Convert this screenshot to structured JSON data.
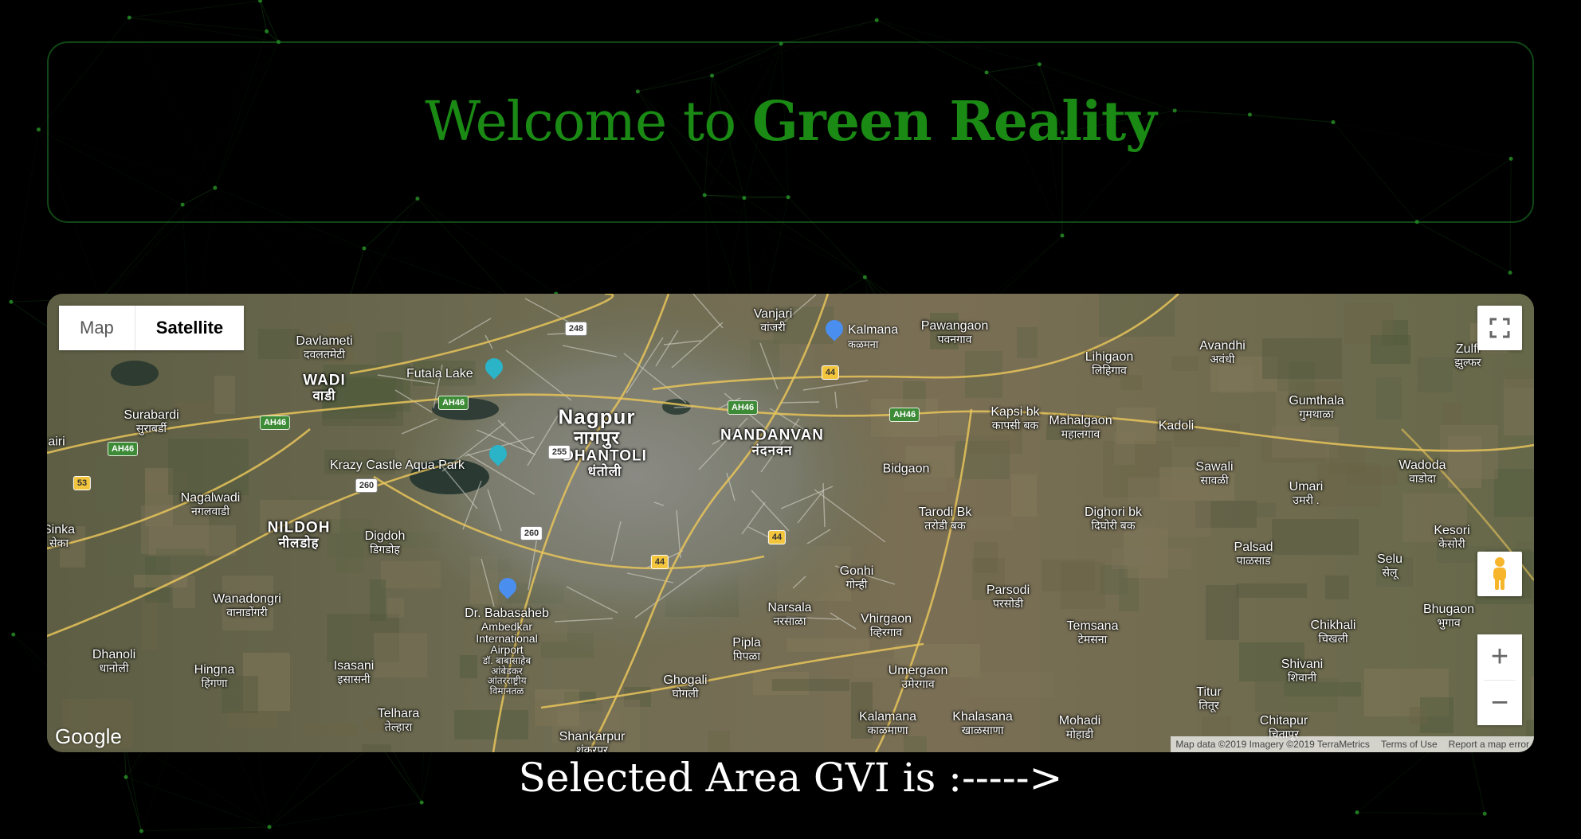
{
  "header": {
    "welcome_prefix": "Welcome to ",
    "brand_name": "Green Reality"
  },
  "map": {
    "type_control": {
      "map_label": "Map",
      "satellite_label": "Satellite",
      "selected": "Satellite"
    },
    "controls": {
      "fullscreen_icon": "fullscreen-icon",
      "pegman_icon": "pegman-icon",
      "zoom_in": "+",
      "zoom_out": "−"
    },
    "logo": "Google",
    "attribution": {
      "data": "Map data ©2019 Imagery ©2019 TerraMetrics",
      "terms": "Terms of Use",
      "report": "Report a map error"
    },
    "labels": {
      "nagpur": "Nagpur",
      "nagpur_local": "नागपुर",
      "nandanvan": "NANDANVAN",
      "nandanvan_local": "नंदनवन",
      "dhantoli": "DHANTOLI",
      "dhantoli_local": "धंतोली",
      "wadi": "WADI",
      "wadi_local": "वाडी",
      "nildoh": "NILDOH",
      "nildoh_local": "नीलडोह",
      "davlameti": "Davlameti",
      "davlameti_local": "दवलतमेटी",
      "surabardi": "Surabardi",
      "surabardi_local": "सुराबर्डी",
      "nagalwadi": "Nagalwadi",
      "nagalwadi_local": "नगलवाडी",
      "sinka": "Sinka",
      "sinka_local": "सेका",
      "airi": "airi",
      "digdoh": "Digdoh",
      "digdoh_local": "डिगडोह",
      "wanadongri": "Wanadongri",
      "wanadongri_local": "वानाडोंगरी",
      "dhanoli": "Dhanoli",
      "dhanoli_local": "धानोली",
      "hingna": "Hingna",
      "hingna_local": "हिंगणा",
      "isasani": "Isasani",
      "isasani_local": "इसासनी",
      "telhara": "Telhara",
      "telhara_local": "तेल्हारा",
      "airport_1": "Dr. Babasaheb",
      "airport_2": "Ambedkar",
      "airport_3": "International",
      "airport_4": "Airport",
      "airport_local_1": "डॉ. बाबासाहेब",
      "airport_local_2": "आंबेडकर",
      "airport_local_3": "आंतरराष्ट्रीय",
      "airport_local_4": "विमानतळ",
      "shankarpur": "Shankarpur",
      "shankarpur_local": "शंकरपूर",
      "ghogali": "Ghogali",
      "ghogali_local": "घोगली",
      "pipla": "Pipla",
      "pipla_local": "पिपळा",
      "narsala": "Narsala",
      "narsala_local": "नरसाळा",
      "gonhi": "Gonhi",
      "gonhi_local": "गोन्ही",
      "vhirgaon": "Vhirgaon",
      "vhirgaon_local": "व्हिरगाव",
      "umergaon": "Umergaon",
      "umergaon_local": "उमेरगाव",
      "kalamana": "Kalamana",
      "kalamana_local": "काळमाणा",
      "khalasana": "Khalasana",
      "khalasana_local": "खाळसाणा",
      "bidgaon": "Bidgaon",
      "tarodi": "Tarodi Bk",
      "tarodi_local": "तरोडी बक",
      "kapsi": "Kapsi bk",
      "kapsi_local": "कापसी बक",
      "pawangaon": "Pawangaon",
      "pawangaon_local": "पवनगाव",
      "vanjari": "Vanjari",
      "vanjari_local": "वांजरी",
      "lihigaon": "Lihigaon",
      "lihigaon_local": "लिहिगाव",
      "mahalgaon": "Mahalgaon",
      "mahalgaon_local": "महालगाव",
      "kadoli": "Kadoli",
      "avandhi": "Avandhi",
      "avandhi_local": "अवंधी",
      "gumthala": "Gumthala",
      "gumthala_local": "गुमथाळा",
      "zulfi": "Zulfi",
      "zulfi_local": "झुल्फर",
      "wadoda": "Wadoda",
      "wadoda_local": "वाडोदा",
      "sawali": "Sawali",
      "sawali_local": "सावळी",
      "umari": "Umari",
      "umari_local": "उमरी .",
      "dighori": "Dighori bk",
      "dighori_local": "दिघोरी बक",
      "palsad": "Palsad",
      "palsad_local": "पाळसाड",
      "selu": "Selu",
      "selu_local": "सेलू",
      "kesori": "Kesori",
      "kesori_local": "केसोरी",
      "parsodi": "Parsodi",
      "parsodi_local": "परसोडी",
      "temsana": "Temsana",
      "temsana_local": "टेमसना",
      "chikhali": "Chikhali",
      "chikhali_local": "चिखली",
      "bhugaon": "Bhugaon",
      "bhugaon_local": "भुगाव",
      "shivani": "Shivani",
      "shivani_local": "शिवानी",
      "titur": "Titur",
      "titur_local": "तितूर",
      "chitapur": "Chitapur",
      "chitapur_local": "चितापूर",
      "mohadi": "Mohadi",
      "mohadi_local": "मोहाडी"
    },
    "pois": {
      "futala": "Futala Lake",
      "krazy_castle": "Krazy Castle Aqua Park",
      "kalmana": "Kalmana",
      "kalmana_local": "कळमना"
    },
    "shields": {
      "s248": "248",
      "s44a": "44",
      "s44b": "44",
      "s44c": "44",
      "ah46a": "AH46",
      "ah46b": "AH46",
      "ah46c": "AH46",
      "ah46d": "AH46",
      "ah46e": "AH46",
      "s255": "255",
      "s260a": "260",
      "s260b": "260",
      "s53": "53"
    }
  },
  "footer": {
    "gvi_text": "Selected Area GVI is :----->"
  },
  "colors": {
    "brand_green": "#1a8a15",
    "panel_border": "#1e8228",
    "network_line": "#1f7a1f"
  }
}
